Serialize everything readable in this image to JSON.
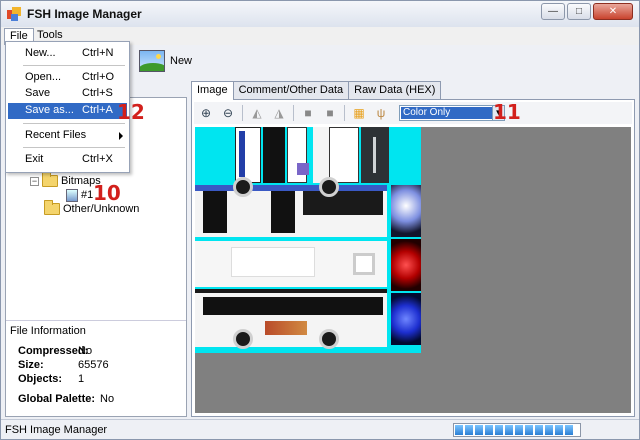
{
  "window": {
    "title": "FSH Image Manager"
  },
  "menu": {
    "file": "File",
    "tools": "Tools"
  },
  "toolbar": {
    "new_label": "New"
  },
  "file_menu": {
    "new": {
      "label": "New...",
      "shortcut": "Ctrl+N"
    },
    "open": {
      "label": "Open...",
      "shortcut": "Ctrl+O"
    },
    "save": {
      "label": "Save",
      "shortcut": "Ctrl+S"
    },
    "save_as": {
      "label": "Save as...",
      "shortcut": "Ctrl+A"
    },
    "recent": {
      "label": "Recent Files"
    },
    "exit": {
      "label": "Exit",
      "shortcut": "Ctrl+X"
    }
  },
  "tree": {
    "bitmaps": "Bitmaps",
    "item": "#1",
    "other": "Other/Unknown"
  },
  "file_info": {
    "title": "File Information",
    "compressed_label": "Compressed:",
    "compressed_value": "No",
    "size_label": "Size:",
    "size_value": "65576",
    "objects_label": "Objects:",
    "objects_value": "1",
    "palette_label": "Global Palette:",
    "palette_value": "No"
  },
  "tabs": {
    "image": "Image",
    "comment": "Comment/Other Data",
    "raw": "Raw Data (HEX)"
  },
  "image_toolbar": {
    "color_mode": "Color Only"
  },
  "annotations": {
    "n10": "10",
    "n11": "11",
    "n12": "12"
  },
  "status": {
    "text": "FSH Image Manager",
    "progress_percent": 100
  },
  "colors": {
    "accent": "#316ac5",
    "annotation": "#d2201c",
    "texture_bg": "#00e5f0"
  }
}
